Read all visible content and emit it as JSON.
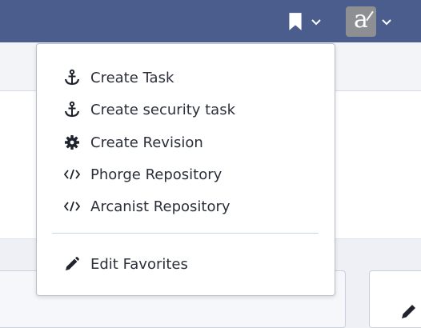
{
  "topbar": {
    "bookmark_icon": "bookmark-icon",
    "user_avatar_letter": "a",
    "colors": {
      "bar": "#4b5d8d",
      "avatar": "#8d8f93"
    }
  },
  "favorites_menu": {
    "items": [
      {
        "label": "Create Task",
        "icon": "anchor-icon"
      },
      {
        "label": "Create security task",
        "icon": "anchor-icon"
      },
      {
        "label": "Create Revision",
        "icon": "gear-icon"
      },
      {
        "label": "Phorge Repository",
        "icon": "code-icon"
      },
      {
        "label": "Arcanist Repository",
        "icon": "code-icon"
      }
    ],
    "edit": {
      "label": "Edit Favorites",
      "icon": "pencil-icon"
    }
  }
}
